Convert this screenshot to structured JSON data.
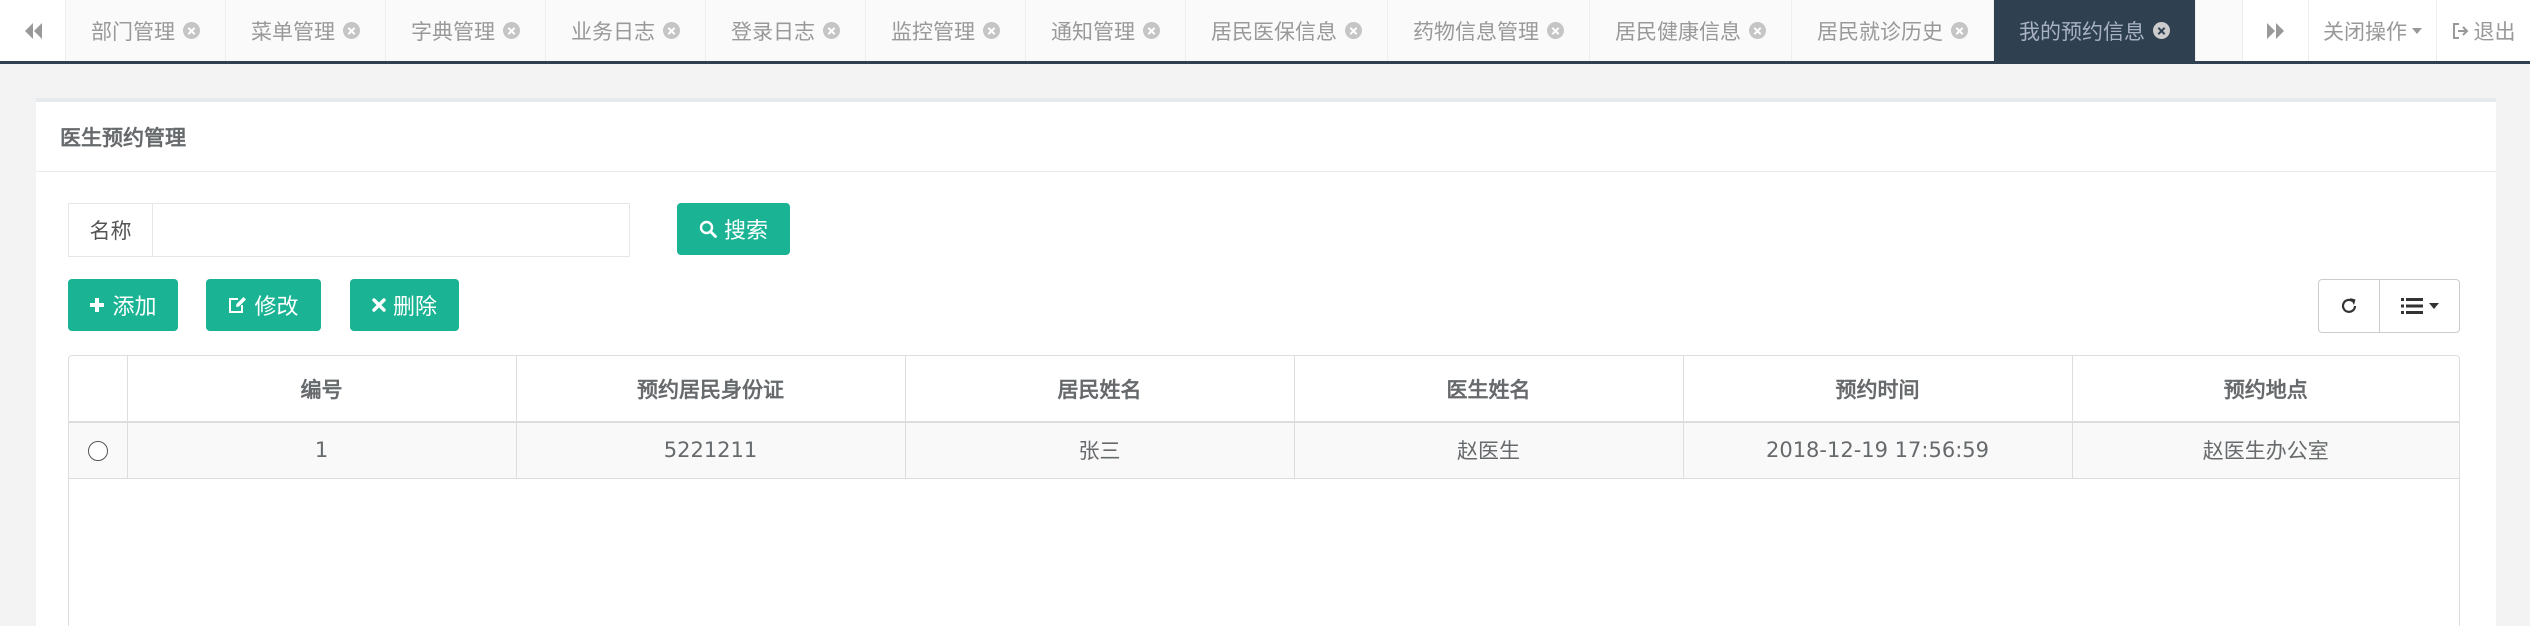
{
  "tabbar": {
    "tabs": [
      {
        "label": "部门管理",
        "active": false
      },
      {
        "label": "菜单管理",
        "active": false
      },
      {
        "label": "字典管理",
        "active": false
      },
      {
        "label": "业务日志",
        "active": false
      },
      {
        "label": "登录日志",
        "active": false
      },
      {
        "label": "监控管理",
        "active": false
      },
      {
        "label": "通知管理",
        "active": false
      },
      {
        "label": "居民医保信息",
        "active": false
      },
      {
        "label": "药物信息管理",
        "active": false
      },
      {
        "label": "居民健康信息",
        "active": false
      },
      {
        "label": "居民就诊历史",
        "active": false
      },
      {
        "label": "我的预约信息",
        "active": true
      }
    ],
    "close_ops_label": "关闭操作",
    "logout_label": "退出"
  },
  "panel": {
    "title": "医生预约管理"
  },
  "search": {
    "label": "名称",
    "value": "",
    "placeholder": "",
    "button_label": "搜索"
  },
  "toolbar": {
    "add_label": "添加",
    "edit_label": "修改",
    "delete_label": "删除"
  },
  "table": {
    "columns": [
      "编号",
      "预约居民身份证",
      "居民姓名",
      "医生姓名",
      "预约时间",
      "预约地点"
    ],
    "rows": [
      [
        "1",
        "5221211",
        "张三",
        "赵医生",
        "2018-12-19 17:56:59",
        "赵医生办公室"
      ]
    ]
  },
  "colors": {
    "primary": "#1ab394",
    "nav_dark": "#2f4050"
  }
}
